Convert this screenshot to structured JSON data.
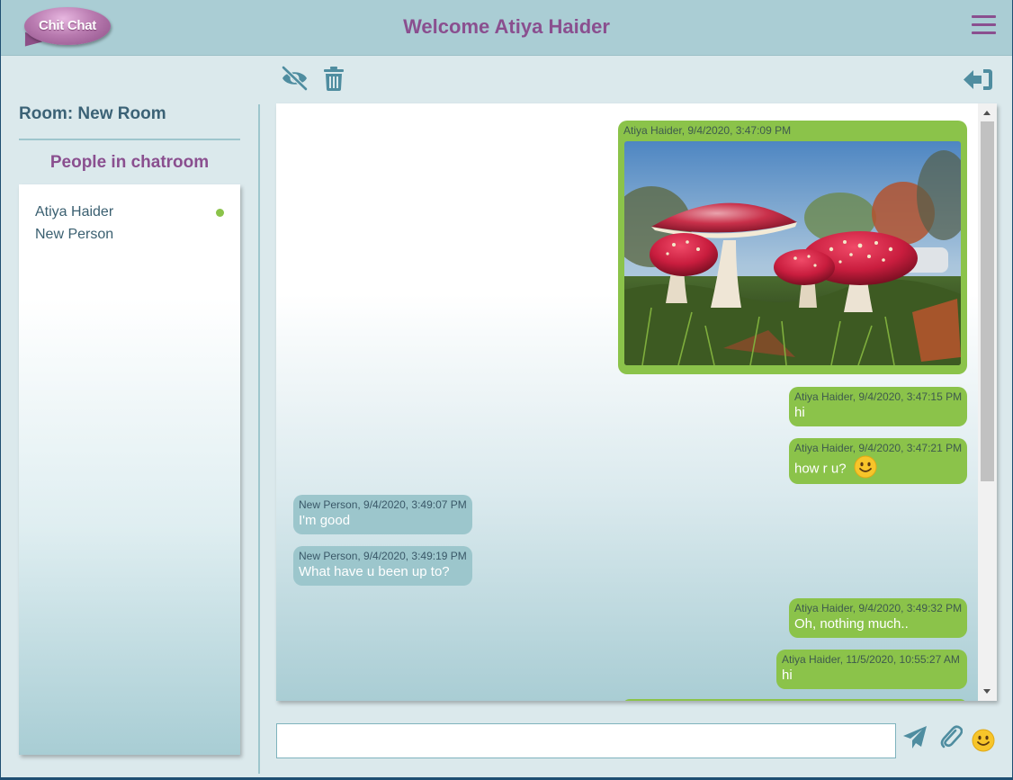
{
  "app": {
    "logo_text": "Chit Chat",
    "welcome": "Welcome Atiya Haider"
  },
  "colors": {
    "header_bg": "#aacdd4",
    "accent_purple": "#8a4f8f",
    "own_message": "#8bc34a",
    "other_message": "#9cc6cc",
    "toolbar_icon": "#4f8da0",
    "online_dot": "#8bc34a"
  },
  "icons": {
    "menu": "hamburger-icon",
    "hide": "eye-slash-icon",
    "delete": "trash-icon",
    "leave": "sign-out-icon",
    "send": "paper-plane-icon",
    "attach": "paperclip-icon",
    "emoji": "smiley-icon"
  },
  "sidebar": {
    "room_label": "Room: New Room",
    "people_heading": "People in chatroom",
    "people": [
      {
        "name": "Atiya Haider",
        "online": true
      },
      {
        "name": "New Person",
        "online": false
      }
    ]
  },
  "messages": [
    {
      "meta": "Atiya Haider, 9/4/2020, 3:47:09 PM",
      "text": "",
      "type": "image",
      "own": true
    },
    {
      "meta": "Atiya Haider, 9/4/2020, 3:47:15 PM",
      "text": "hi",
      "own": true
    },
    {
      "meta": "Atiya Haider, 9/4/2020, 3:47:21 PM",
      "text": "how r u?",
      "emoji": "smiley",
      "own": true
    },
    {
      "meta": "New Person, 9/4/2020, 3:49:07 PM",
      "text": "I'm good",
      "own": false
    },
    {
      "meta": "New Person, 9/4/2020, 3:49:19 PM",
      "text": "What have u been up to?",
      "own": false
    },
    {
      "meta": "Atiya Haider, 9/4/2020, 3:49:32 PM",
      "text": "Oh, nothing much..",
      "own": true
    },
    {
      "meta": "Atiya Haider, 11/5/2020, 10:55:27 AM",
      "text": "hi",
      "own": true
    }
  ],
  "composer": {
    "value": "",
    "placeholder": ""
  }
}
